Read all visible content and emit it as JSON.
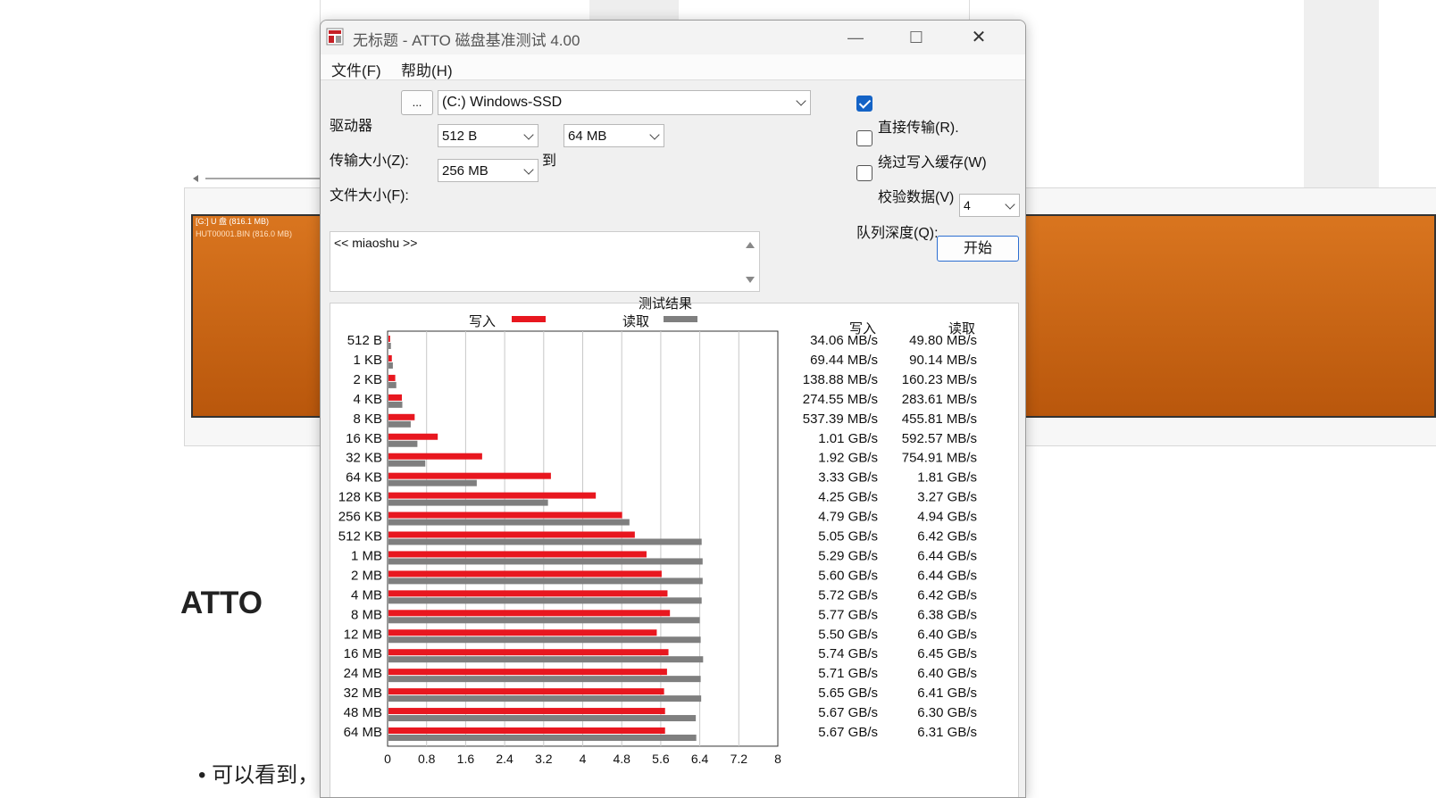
{
  "window": {
    "title": "无标题 - ATTO 磁盘基准测试 4.00",
    "minimize": "—",
    "maximize": "☐",
    "close": "✕"
  },
  "menu": {
    "file": "文件(F)",
    "help": "帮助(H)"
  },
  "form": {
    "drive_label": "驱动器",
    "browse_label": "...",
    "drive_value": "(C:) Windows-SSD",
    "transfer_size_label": "传输大小(Z):",
    "transfer_from": "512 B",
    "to_label": "到",
    "transfer_to": "64 MB",
    "file_size_label": "文件大小(F):",
    "file_size": "256 MB",
    "direct_io_label": "直接传输(R).",
    "direct_io_checked": true,
    "bypass_cache_label": "绕过写入缓存(W)",
    "bypass_cache_checked": false,
    "verify_label": "校验数据(V)",
    "verify_checked": false,
    "queue_label": "队列深度(Q):",
    "queue_value": "4",
    "start_label": "开始",
    "description": "<< miaoshu >>"
  },
  "results": {
    "title": "测试结果",
    "legend_write": "写入",
    "legend_read": "读取",
    "col_write": "写入",
    "col_read": "读取",
    "write_color": "#e8171f",
    "read_color": "#7f7f7f",
    "rows": [
      {
        "size": "512 B",
        "write": "34.06 MB/s",
        "read": "49.80 MB/s"
      },
      {
        "size": "1 KB",
        "write": "69.44 MB/s",
        "read": "90.14 MB/s"
      },
      {
        "size": "2 KB",
        "write": "138.88 MB/s",
        "read": "160.23 MB/s"
      },
      {
        "size": "4 KB",
        "write": "274.55 MB/s",
        "read": "283.61 MB/s"
      },
      {
        "size": "8 KB",
        "write": "537.39 MB/s",
        "read": "455.81 MB/s"
      },
      {
        "size": "16 KB",
        "write": "1.01 GB/s",
        "read": "592.57 MB/s"
      },
      {
        "size": "32 KB",
        "write": "1.92 GB/s",
        "read": "754.91 MB/s"
      },
      {
        "size": "64 KB",
        "write": "3.33 GB/s",
        "read": "1.81 GB/s"
      },
      {
        "size": "128 KB",
        "write": "4.25 GB/s",
        "read": "3.27 GB/s"
      },
      {
        "size": "256 KB",
        "write": "4.79 GB/s",
        "read": "4.94 GB/s"
      },
      {
        "size": "512 KB",
        "write": "5.05 GB/s",
        "read": "6.42 GB/s"
      },
      {
        "size": "1 MB",
        "write": "5.29 GB/s",
        "read": "6.44 GB/s"
      },
      {
        "size": "2 MB",
        "write": "5.60 GB/s",
        "read": "6.44 GB/s"
      },
      {
        "size": "4 MB",
        "write": "5.72 GB/s",
        "read": "6.42 GB/s"
      },
      {
        "size": "8 MB",
        "write": "5.77 GB/s",
        "read": "6.38 GB/s"
      },
      {
        "size": "12 MB",
        "write": "5.50 GB/s",
        "read": "6.40 GB/s"
      },
      {
        "size": "16 MB",
        "write": "5.74 GB/s",
        "read": "6.45 GB/s"
      },
      {
        "size": "24 MB",
        "write": "5.71 GB/s",
        "read": "6.40 GB/s"
      },
      {
        "size": "32 MB",
        "write": "5.65 GB/s",
        "read": "6.41 GB/s"
      },
      {
        "size": "48 MB",
        "write": "5.67 GB/s",
        "read": "6.30 GB/s"
      },
      {
        "size": "64 MB",
        "write": "5.67 GB/s",
        "read": "6.31 GB/s"
      }
    ]
  },
  "chart_data": {
    "type": "bar",
    "title": "测试结果",
    "categories": [
      "512 B",
      "1 KB",
      "2 KB",
      "4 KB",
      "8 KB",
      "16 KB",
      "32 KB",
      "64 KB",
      "128 KB",
      "256 KB",
      "512 KB",
      "1 MB",
      "2 MB",
      "4 MB",
      "8 MB",
      "12 MB",
      "16 MB",
      "24 MB",
      "32 MB",
      "48 MB",
      "64 MB"
    ],
    "series": [
      {
        "name": "写入",
        "values": [
          0.034,
          0.069,
          0.139,
          0.275,
          0.537,
          1.01,
          1.92,
          3.33,
          4.25,
          4.79,
          5.05,
          5.29,
          5.6,
          5.72,
          5.77,
          5.5,
          5.74,
          5.71,
          5.65,
          5.67,
          5.67
        ]
      },
      {
        "name": "读取",
        "values": [
          0.05,
          0.09,
          0.16,
          0.284,
          0.456,
          0.593,
          0.755,
          1.81,
          3.27,
          4.94,
          6.42,
          6.44,
          6.44,
          6.42,
          6.38,
          6.4,
          6.45,
          6.4,
          6.41,
          6.3,
          6.31
        ]
      }
    ],
    "xticks": [
      "0",
      "0.8",
      "1.6",
      "2.4",
      "3.2",
      "4",
      "4.8",
      "5.6",
      "6.4",
      "7.2",
      "8"
    ],
    "xlim": [
      0,
      8
    ],
    "orientation": "horizontal",
    "grid": true,
    "legend": "top"
  },
  "background": {
    "drive_label": "[G:] U 盘  (816.1 MB)",
    "file_label": "HUT00001.BIN (816.0 MB)",
    "heading": "ATTO",
    "bullet": "可以看到，"
  }
}
